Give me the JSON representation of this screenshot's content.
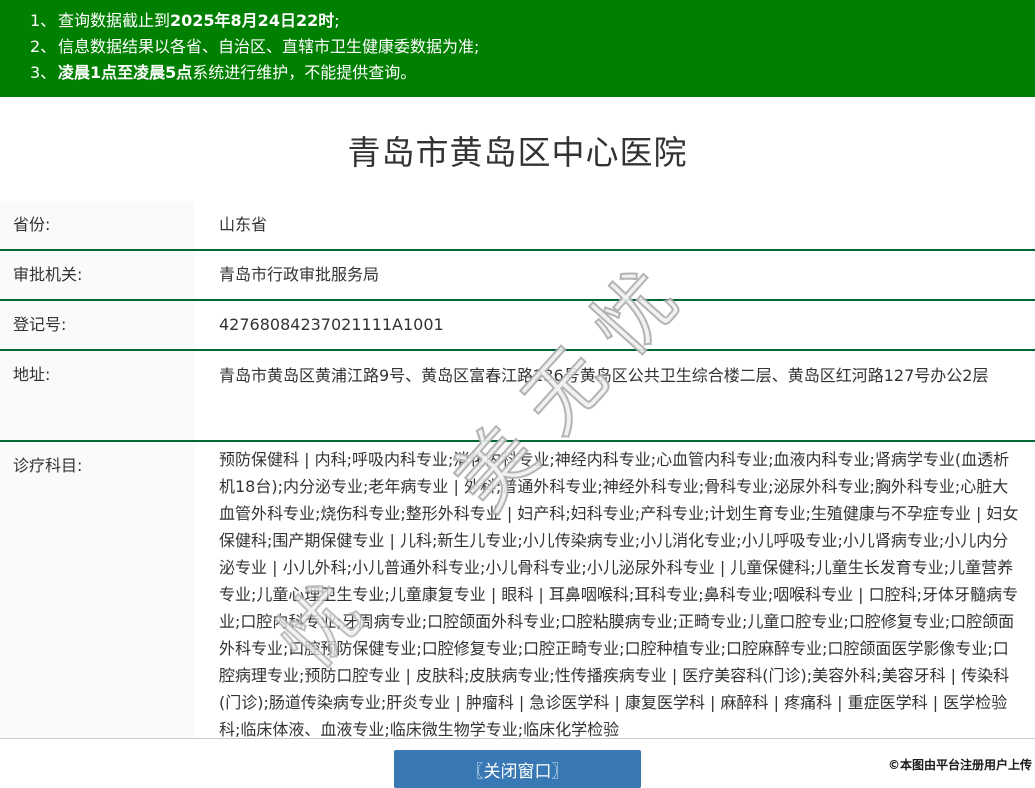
{
  "notice": {
    "items": [
      {
        "num": "1、",
        "seg_pre": "查询数据截止到",
        "seg_bold": "2025年8月24日22时",
        "seg_post": ";"
      },
      {
        "num": "2、",
        "seg_pre": "信息数据结果以各省、自治区、直辖市卫生健康委数据为准;"
      },
      {
        "num": "3、",
        "seg_bold": "凌晨1点至凌晨5点",
        "seg_post": "系统进行维护，不能提供查询。"
      }
    ]
  },
  "title": "青岛市黄岛区中心医院",
  "details": {
    "rows": [
      {
        "label": "省份:",
        "value": "山东省"
      },
      {
        "label": "审批机关:",
        "value": "青岛市行政审批服务局"
      },
      {
        "label": "登记号:",
        "value": "42768084237021111A1001"
      },
      {
        "label": "地址:",
        "value": "青岛市黄岛区黄浦江路9号、黄岛区富春江路236号黄岛区公共卫生综合楼二层、黄岛区红河路127号办公2层"
      },
      {
        "label": "诊疗科目:",
        "value": "预防保健科 | 内科;呼吸内科专业;消化内科专业;神经内科专业;心血管内科专业;血液内科专业;肾病学专业(血透析机18台);内分泌专业;老年病专业 | 外科;普通外科专业;神经外科专业;骨科专业;泌尿外科专业;胸外科专业;心脏大血管外科专业;烧伤科专业;整形外科专业 | 妇产科;妇科专业;产科专业;计划生育专业;生殖健康与不孕症专业 | 妇女保健科;围产期保健专业 | 儿科;新生儿专业;小儿传染病专业;小儿消化专业;小儿呼吸专业;小儿肾病专业;小儿内分泌专业 | 小儿外科;小儿普通外科专业;小儿骨科专业;小儿泌尿外科专业 | 儿童保健科;儿童生长发育专业;儿童营养专业;儿童心理卫生专业;儿童康复专业 | 眼科 | 耳鼻咽喉科;耳科专业;鼻科专业;咽喉科专业 | 口腔科;牙体牙髓病专业;口腔内科专业;牙周病专业;口腔颌面外科专业;口腔粘膜病专业;正畸专业;儿童口腔专业;口腔修复专业;口腔颌面外科专业;口腔预防保健专业;口腔修复专业;口腔正畸专业;口腔种植专业;口腔麻醉专业;口腔颌面医学影像专业;口腔病理专业;预防口腔专业 | 皮肤科;皮肤病专业;性传播疾病专业 | 医疗美容科(门诊);美容外科;美容牙科 | 传染科(门诊);肠道传染病专业;肝炎专业 | 肿瘤科 | 急诊医学科 | 康复医学科 | 麻醉科 | 疼痛科 | 重症医学科 | 医学检验科;临床体液、血液专业;临床微生物学专业;临床化学检验"
      }
    ]
  },
  "close_button": {
    "label": "〖关闭窗口〗"
  },
  "watermark": {
    "text": "美无忧",
    "partial": "忧"
  },
  "footer": {
    "note": "©本图由平台注册用户上传"
  },
  "colors": {
    "banner_green": "#008000",
    "row_border_green": "#006633",
    "button_blue": "#3879b5",
    "label_bg": "#fafafa"
  }
}
